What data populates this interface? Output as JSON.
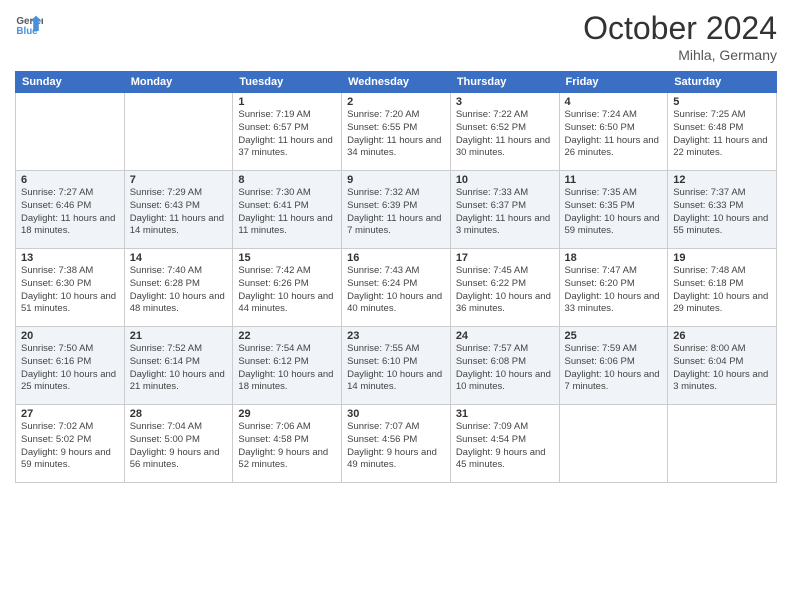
{
  "header": {
    "logo_line1": "General",
    "logo_line2": "Blue",
    "month": "October 2024",
    "location": "Mihla, Germany"
  },
  "weekdays": [
    "Sunday",
    "Monday",
    "Tuesday",
    "Wednesday",
    "Thursday",
    "Friday",
    "Saturday"
  ],
  "weeks": [
    [
      {
        "day": "",
        "info": ""
      },
      {
        "day": "",
        "info": ""
      },
      {
        "day": "1",
        "info": "Sunrise: 7:19 AM\nSunset: 6:57 PM\nDaylight: 11 hours and 37 minutes."
      },
      {
        "day": "2",
        "info": "Sunrise: 7:20 AM\nSunset: 6:55 PM\nDaylight: 11 hours and 34 minutes."
      },
      {
        "day": "3",
        "info": "Sunrise: 7:22 AM\nSunset: 6:52 PM\nDaylight: 11 hours and 30 minutes."
      },
      {
        "day": "4",
        "info": "Sunrise: 7:24 AM\nSunset: 6:50 PM\nDaylight: 11 hours and 26 minutes."
      },
      {
        "day": "5",
        "info": "Sunrise: 7:25 AM\nSunset: 6:48 PM\nDaylight: 11 hours and 22 minutes."
      }
    ],
    [
      {
        "day": "6",
        "info": "Sunrise: 7:27 AM\nSunset: 6:46 PM\nDaylight: 11 hours and 18 minutes."
      },
      {
        "day": "7",
        "info": "Sunrise: 7:29 AM\nSunset: 6:43 PM\nDaylight: 11 hours and 14 minutes."
      },
      {
        "day": "8",
        "info": "Sunrise: 7:30 AM\nSunset: 6:41 PM\nDaylight: 11 hours and 11 minutes."
      },
      {
        "day": "9",
        "info": "Sunrise: 7:32 AM\nSunset: 6:39 PM\nDaylight: 11 hours and 7 minutes."
      },
      {
        "day": "10",
        "info": "Sunrise: 7:33 AM\nSunset: 6:37 PM\nDaylight: 11 hours and 3 minutes."
      },
      {
        "day": "11",
        "info": "Sunrise: 7:35 AM\nSunset: 6:35 PM\nDaylight: 10 hours and 59 minutes."
      },
      {
        "day": "12",
        "info": "Sunrise: 7:37 AM\nSunset: 6:33 PM\nDaylight: 10 hours and 55 minutes."
      }
    ],
    [
      {
        "day": "13",
        "info": "Sunrise: 7:38 AM\nSunset: 6:30 PM\nDaylight: 10 hours and 51 minutes."
      },
      {
        "day": "14",
        "info": "Sunrise: 7:40 AM\nSunset: 6:28 PM\nDaylight: 10 hours and 48 minutes."
      },
      {
        "day": "15",
        "info": "Sunrise: 7:42 AM\nSunset: 6:26 PM\nDaylight: 10 hours and 44 minutes."
      },
      {
        "day": "16",
        "info": "Sunrise: 7:43 AM\nSunset: 6:24 PM\nDaylight: 10 hours and 40 minutes."
      },
      {
        "day": "17",
        "info": "Sunrise: 7:45 AM\nSunset: 6:22 PM\nDaylight: 10 hours and 36 minutes."
      },
      {
        "day": "18",
        "info": "Sunrise: 7:47 AM\nSunset: 6:20 PM\nDaylight: 10 hours and 33 minutes."
      },
      {
        "day": "19",
        "info": "Sunrise: 7:48 AM\nSunset: 6:18 PM\nDaylight: 10 hours and 29 minutes."
      }
    ],
    [
      {
        "day": "20",
        "info": "Sunrise: 7:50 AM\nSunset: 6:16 PM\nDaylight: 10 hours and 25 minutes."
      },
      {
        "day": "21",
        "info": "Sunrise: 7:52 AM\nSunset: 6:14 PM\nDaylight: 10 hours and 21 minutes."
      },
      {
        "day": "22",
        "info": "Sunrise: 7:54 AM\nSunset: 6:12 PM\nDaylight: 10 hours and 18 minutes."
      },
      {
        "day": "23",
        "info": "Sunrise: 7:55 AM\nSunset: 6:10 PM\nDaylight: 10 hours and 14 minutes."
      },
      {
        "day": "24",
        "info": "Sunrise: 7:57 AM\nSunset: 6:08 PM\nDaylight: 10 hours and 10 minutes."
      },
      {
        "day": "25",
        "info": "Sunrise: 7:59 AM\nSunset: 6:06 PM\nDaylight: 10 hours and 7 minutes."
      },
      {
        "day": "26",
        "info": "Sunrise: 8:00 AM\nSunset: 6:04 PM\nDaylight: 10 hours and 3 minutes."
      }
    ],
    [
      {
        "day": "27",
        "info": "Sunrise: 7:02 AM\nSunset: 5:02 PM\nDaylight: 9 hours and 59 minutes."
      },
      {
        "day": "28",
        "info": "Sunrise: 7:04 AM\nSunset: 5:00 PM\nDaylight: 9 hours and 56 minutes."
      },
      {
        "day": "29",
        "info": "Sunrise: 7:06 AM\nSunset: 4:58 PM\nDaylight: 9 hours and 52 minutes."
      },
      {
        "day": "30",
        "info": "Sunrise: 7:07 AM\nSunset: 4:56 PM\nDaylight: 9 hours and 49 minutes."
      },
      {
        "day": "31",
        "info": "Sunrise: 7:09 AM\nSunset: 4:54 PM\nDaylight: 9 hours and 45 minutes."
      },
      {
        "day": "",
        "info": ""
      },
      {
        "day": "",
        "info": ""
      }
    ]
  ]
}
